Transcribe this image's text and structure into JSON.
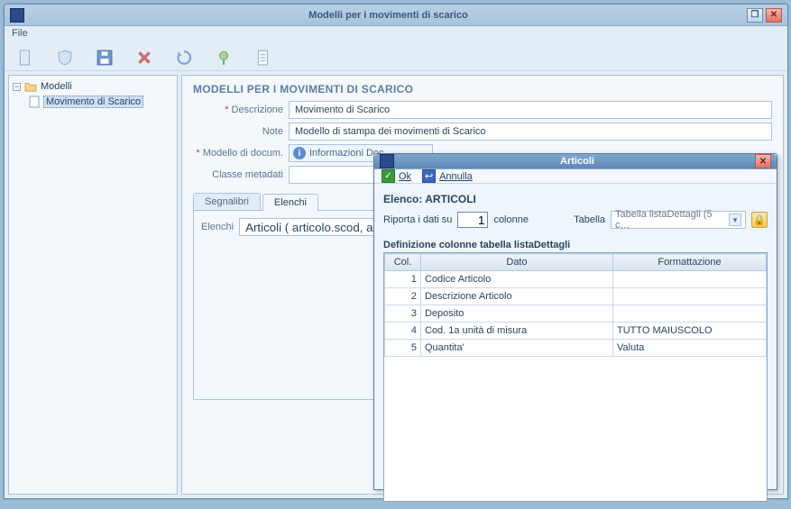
{
  "window": {
    "title": "Modelli per i movimenti di scarico",
    "menu_file": "File"
  },
  "tree": {
    "root": "Modelli",
    "child": "Movimento di Scarico"
  },
  "form": {
    "heading": "MODELLI PER I MOVIMENTI DI SCARICO",
    "labels": {
      "descrizione": "Descrizione",
      "note": "Note",
      "modello": "Modello di docum.",
      "classe": "Classe metadati"
    },
    "values": {
      "descrizione": "Movimento di Scarico",
      "note": "Modello di stampa dei movimenti di Scarico",
      "info_chip": "Informazioni Doc.",
      "classe": ""
    }
  },
  "tabs": {
    "segnalibri": "Segnalibri",
    "elenchi": "Elenchi"
  },
  "elenchi": {
    "label": "Elenchi",
    "value": "Articoli ( articolo.scod, articolo, de"
  },
  "dialog": {
    "title": "Articoli",
    "ok": "Ok",
    "cancel": "Annulla",
    "heading": "Elenco: ARTICOLI",
    "riporta_pre": "Riporta i dati su",
    "riporta_val": "1",
    "riporta_post": "colonne",
    "tabella_label": "Tabella",
    "tabella_value": "Tabella listaDettagli (5 c…",
    "section": "Definizione colonne tabella listaDettagli",
    "columns": {
      "col": "Col.",
      "dato": "Dato",
      "fmt": "Formattazione"
    },
    "rows": [
      {
        "n": "1",
        "dato": "Codice Articolo",
        "fmt": ""
      },
      {
        "n": "2",
        "dato": "Descrizione Articolo",
        "fmt": ""
      },
      {
        "n": "3",
        "dato": "Deposito",
        "fmt": ""
      },
      {
        "n": "4",
        "dato": "Cod. 1a unità di misura",
        "fmt": "TUTTO MAIUSCOLO"
      },
      {
        "n": "5",
        "dato": "Quantita'",
        "fmt": "Valuta"
      }
    ]
  }
}
